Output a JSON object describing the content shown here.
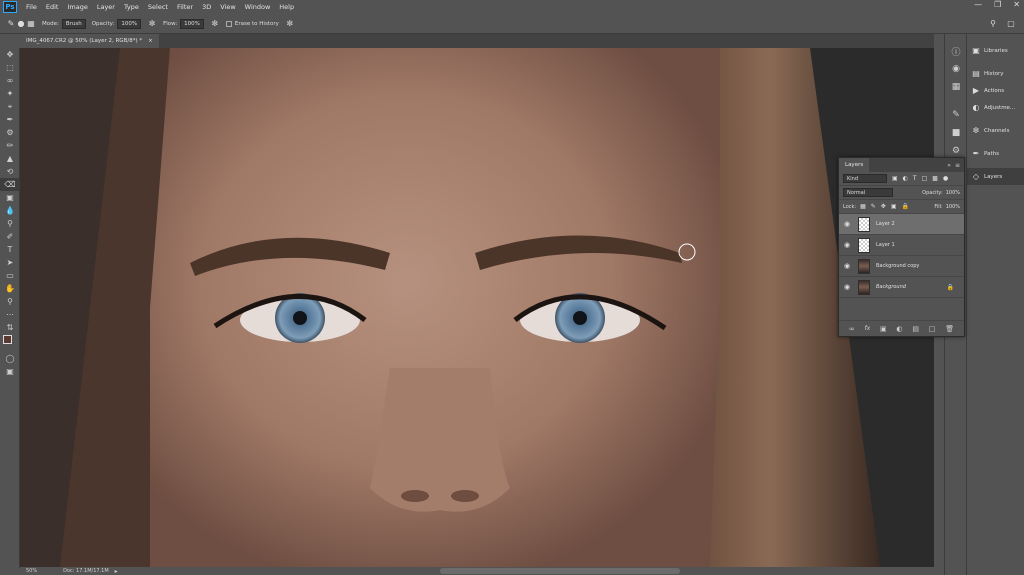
{
  "app": {
    "logo": "Ps"
  },
  "menu": [
    "File",
    "Edit",
    "Image",
    "Layer",
    "Type",
    "Select",
    "Filter",
    "3D",
    "View",
    "Window",
    "Help"
  ],
  "options": {
    "mode_label": "Mode:",
    "mode_value": "Brush",
    "opacity_label": "Opacity:",
    "opacity_value": "100%",
    "flow_label": "Flow:",
    "flow_value": "100%",
    "erase_history": "Erase to History"
  },
  "document": {
    "tab_title": "IMG_4067.CR2 @ 50% (Layer 2, RGB/8*) *",
    "close": "×"
  },
  "status": {
    "zoom": "50%",
    "doc_info": "Doc: 17.1M/17.1M"
  },
  "right_panels": [
    "Libraries",
    "History",
    "Actions",
    "Adjustme...",
    "Channels",
    "Paths",
    "Layers"
  ],
  "layers_panel": {
    "tab": "Layers",
    "filter": "Kind",
    "blend_mode": "Normal",
    "opacity_label": "Opacity:",
    "opacity_value": "100%",
    "lock_label": "Lock:",
    "fill_label": "Fill:",
    "fill_value": "100%",
    "layers": [
      {
        "name": "Layer 2",
        "thumb": "transparent",
        "selected": true
      },
      {
        "name": "Layer 1",
        "thumb": "transparent",
        "selected": false
      },
      {
        "name": "Background copy",
        "thumb": "photo",
        "selected": false
      },
      {
        "name": "Background",
        "thumb": "photo",
        "selected": false,
        "locked": true
      }
    ]
  },
  "colors": {
    "panel": "#535353",
    "dark": "#424242",
    "selected_layer": "#6e6e6e",
    "accent": "#31a8ff"
  }
}
